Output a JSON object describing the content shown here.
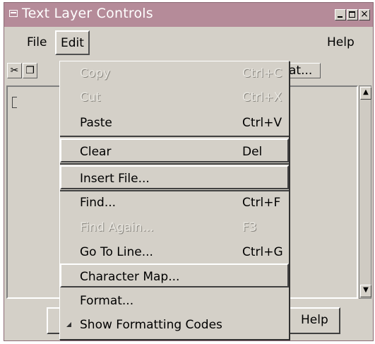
{
  "window": {
    "title": "Text Layer Controls"
  },
  "menubar": {
    "file": "File",
    "edit": "Edit",
    "help": "Help"
  },
  "toolbar": {
    "format_partial": "at..."
  },
  "footer": {
    "help_button": "Help"
  },
  "edit_menu": {
    "items": [
      {
        "label": "Copy",
        "accel": "Ctrl+C",
        "enabled": false
      },
      {
        "label": "Cut",
        "accel": "Ctrl+X",
        "enabled": false
      },
      {
        "label": "Paste",
        "accel": "Ctrl+V",
        "enabled": true
      },
      {
        "label": "Clear",
        "accel": "Del",
        "enabled": true
      },
      {
        "label": "Insert File...",
        "accel": "",
        "enabled": true
      },
      {
        "label": "Find...",
        "accel": "Ctrl+F",
        "enabled": true
      },
      {
        "label": "Find Again...",
        "accel": "F3",
        "enabled": false
      },
      {
        "label": "Go To Line...",
        "accel": "Ctrl+G",
        "enabled": true
      },
      {
        "label": "Character Map...",
        "accel": "",
        "enabled": true
      },
      {
        "label": "Format...",
        "accel": "",
        "enabled": true
      },
      {
        "label": "Show Formatting Codes",
        "accel": "",
        "enabled": true,
        "checked": true
      }
    ]
  },
  "colors": {
    "title_bar": "#b58b99",
    "face": "#d4d0c8"
  }
}
